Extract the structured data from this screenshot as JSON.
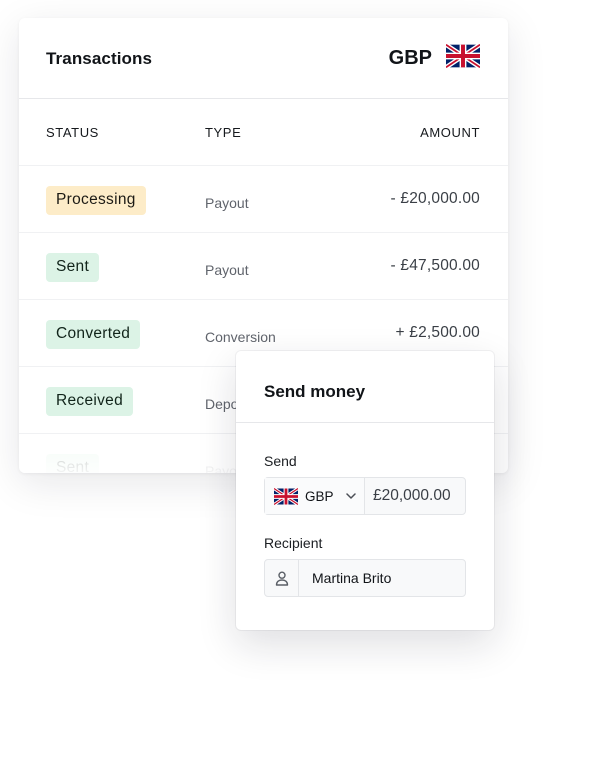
{
  "transactions": {
    "title": "Transactions",
    "currency_code": "GBP",
    "currency_flag_icon": "uk-flag-icon",
    "columns": {
      "status": "STATUS",
      "type": "TYPE",
      "amount": "AMOUNT"
    },
    "rows": [
      {
        "status": "Processing",
        "status_kind": "processing",
        "type": "Payout",
        "amount": "- £20,000.00"
      },
      {
        "status": "Sent",
        "status_kind": "sent",
        "type": "Payout",
        "amount": "- £47,500.00"
      },
      {
        "status": "Converted",
        "status_kind": "converted",
        "type": "Conversion",
        "amount": "+ £2,500.00"
      },
      {
        "status": "Received",
        "status_kind": "received",
        "type": "Depo",
        "amount": ""
      },
      {
        "status": "Sent",
        "status_kind": "sent",
        "type": "Payou",
        "amount": ""
      }
    ]
  },
  "send_money": {
    "title": "Send money",
    "send_label": "Send",
    "currency_code": "GBP",
    "currency_flag_icon": "uk-flag-icon",
    "dropdown_icon": "chevron-down-icon",
    "amount_value": "£20,000.00",
    "recipient_label": "Recipient",
    "recipient_icon": "person-icon",
    "recipient_value": "Martina Brito"
  },
  "colors": {
    "processing_badge": "#fdecc8",
    "success_badge": "#dcf3e6"
  }
}
